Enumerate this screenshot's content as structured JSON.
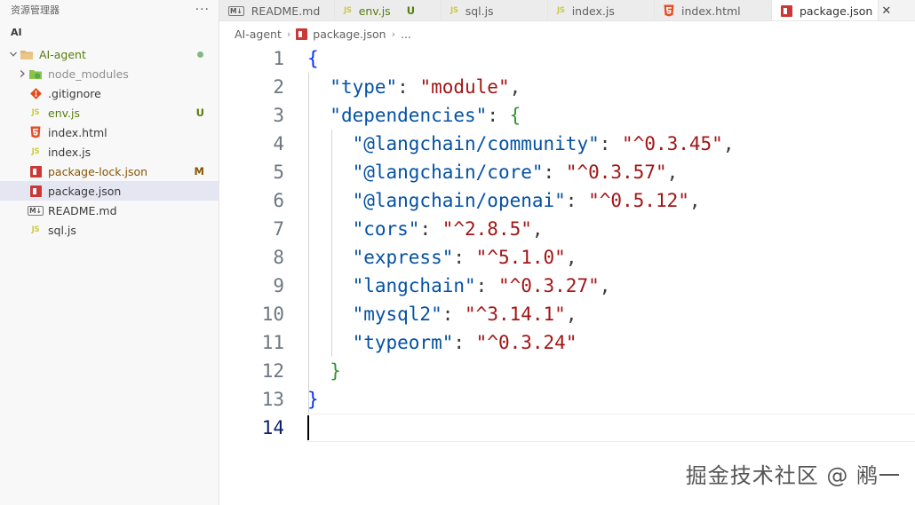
{
  "sidebar": {
    "title": "资源管理器",
    "more": "···",
    "root": "AI",
    "folder": {
      "label": "AI-agent"
    },
    "items": [
      {
        "label": "node_modules",
        "type": "folder"
      },
      {
        "label": ".gitignore",
        "type": "git"
      },
      {
        "label": "env.js",
        "type": "js",
        "badge": "U",
        "badge_color": "#587c0c",
        "label_color": "#587c0c"
      },
      {
        "label": "index.html",
        "type": "html"
      },
      {
        "label": "index.js",
        "type": "js"
      },
      {
        "label": "package-lock.json",
        "type": "npm",
        "badge": "M",
        "badge_color": "#895503",
        "label_color": "#895503"
      },
      {
        "label": "package.json",
        "type": "npm",
        "selected": true
      },
      {
        "label": "README.md",
        "type": "md"
      },
      {
        "label": "sql.js",
        "type": "js"
      }
    ]
  },
  "tabs": [
    {
      "label": "README.md",
      "type": "md"
    },
    {
      "label": "env.js",
      "type": "js",
      "badge": "U",
      "label_color": "#587c0c"
    },
    {
      "label": "sql.js",
      "type": "js"
    },
    {
      "label": "index.js",
      "type": "js"
    },
    {
      "label": "index.html",
      "type": "html"
    },
    {
      "label": "package.json",
      "type": "npm",
      "active": true,
      "close": "✕"
    }
  ],
  "breadcrumb": {
    "folder": "AI-agent",
    "file": "package.json",
    "tail": "..."
  },
  "editor": {
    "active_line": 14,
    "lines": [
      {
        "n": "1",
        "tokens": [
          [
            "brace-blue",
            "{"
          ]
        ]
      },
      {
        "n": "2",
        "tokens": [
          [
            "punct",
            "  "
          ],
          [
            "key",
            "\"type\""
          ],
          [
            "punct",
            ": "
          ],
          [
            "str",
            "\"module\""
          ],
          [
            "punct",
            ","
          ]
        ]
      },
      {
        "n": "3",
        "tokens": [
          [
            "punct",
            "  "
          ],
          [
            "key",
            "\"dependencies\""
          ],
          [
            "punct",
            ": "
          ],
          [
            "brace-green",
            "{"
          ]
        ]
      },
      {
        "n": "4",
        "tokens": [
          [
            "punct",
            "    "
          ],
          [
            "key",
            "\"@langchain/community\""
          ],
          [
            "punct",
            ": "
          ],
          [
            "str",
            "\"^0.3.45\""
          ],
          [
            "punct",
            ","
          ]
        ]
      },
      {
        "n": "5",
        "tokens": [
          [
            "punct",
            "    "
          ],
          [
            "key",
            "\"@langchain/core\""
          ],
          [
            "punct",
            ": "
          ],
          [
            "str",
            "\"^0.3.57\""
          ],
          [
            "punct",
            ","
          ]
        ]
      },
      {
        "n": "6",
        "tokens": [
          [
            "punct",
            "    "
          ],
          [
            "key",
            "\"@langchain/openai\""
          ],
          [
            "punct",
            ": "
          ],
          [
            "str",
            "\"^0.5.12\""
          ],
          [
            "punct",
            ","
          ]
        ]
      },
      {
        "n": "7",
        "tokens": [
          [
            "punct",
            "    "
          ],
          [
            "key",
            "\"cors\""
          ],
          [
            "punct",
            ": "
          ],
          [
            "str",
            "\"^2.8.5\""
          ],
          [
            "punct",
            ","
          ]
        ]
      },
      {
        "n": "8",
        "tokens": [
          [
            "punct",
            "    "
          ],
          [
            "key",
            "\"express\""
          ],
          [
            "punct",
            ": "
          ],
          [
            "str",
            "\"^5.1.0\""
          ],
          [
            "punct",
            ","
          ]
        ]
      },
      {
        "n": "9",
        "tokens": [
          [
            "punct",
            "    "
          ],
          [
            "key",
            "\"langchain\""
          ],
          [
            "punct",
            ": "
          ],
          [
            "str",
            "\"^0.3.27\""
          ],
          [
            "punct",
            ","
          ]
        ]
      },
      {
        "n": "10",
        "tokens": [
          [
            "punct",
            "    "
          ],
          [
            "key",
            "\"mysql2\""
          ],
          [
            "punct",
            ": "
          ],
          [
            "str",
            "\"^3.14.1\""
          ],
          [
            "punct",
            ","
          ]
        ]
      },
      {
        "n": "11",
        "tokens": [
          [
            "punct",
            "    "
          ],
          [
            "key",
            "\"typeorm\""
          ],
          [
            "punct",
            ": "
          ],
          [
            "str",
            "\"^0.3.24\""
          ]
        ]
      },
      {
        "n": "12",
        "tokens": [
          [
            "punct",
            "  "
          ],
          [
            "brace-green",
            "}"
          ]
        ]
      },
      {
        "n": "13",
        "tokens": [
          [
            "brace-blue",
            "}"
          ]
        ]
      },
      {
        "n": "14",
        "tokens": []
      }
    ]
  },
  "watermark": "掘金技术社区 @ 鹇一"
}
